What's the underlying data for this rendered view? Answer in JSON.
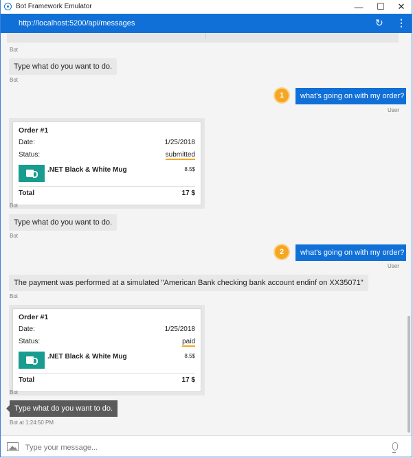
{
  "window": {
    "title": "Bot Framework Emulator",
    "minimize_glyph": "—",
    "maximize_glyph": "☐",
    "close_glyph": "✕"
  },
  "address_bar": {
    "url": "http://localhost:5200/api/messages",
    "refresh_icon": "↻",
    "more_icon": "⋮"
  },
  "labels": {
    "bot": "Bot",
    "user": "User",
    "bot_timestamp": "Bot at 1:24:50 PM"
  },
  "messages": {
    "prompt_1": "Type what do you want to do.",
    "user_1": "what's going on with my order?",
    "callout_1": "1",
    "prompt_2": "Type what do you want to do.",
    "user_2": "what's going on with my order?",
    "callout_2": "2",
    "payment": "The payment was performed at a simulated \"American Bank checking bank account endinf on XX35071\"",
    "prompt_3": "Type what do you want to do."
  },
  "order_card_1": {
    "title": "Order #1",
    "date_label": "Date:",
    "date_value": "1/25/2018",
    "status_label": "Status:",
    "status_value": "submitted",
    "item_name": ".NET Black & White Mug",
    "item_price": "8.5$",
    "total_label": "Total",
    "total_value": "17 $"
  },
  "order_card_2": {
    "title": "Order #1",
    "date_label": "Date:",
    "date_value": "1/25/2018",
    "status_label": "Status:",
    "status_value": "paid",
    "item_name": ".NET Black & White Mug",
    "item_price": "8.5$",
    "total_label": "Total",
    "total_value": "17 $"
  },
  "input": {
    "placeholder": "Type your message..."
  },
  "colors": {
    "accent": "#1070d8",
    "callout": "#f5a623",
    "item_image": "#189c8f"
  }
}
